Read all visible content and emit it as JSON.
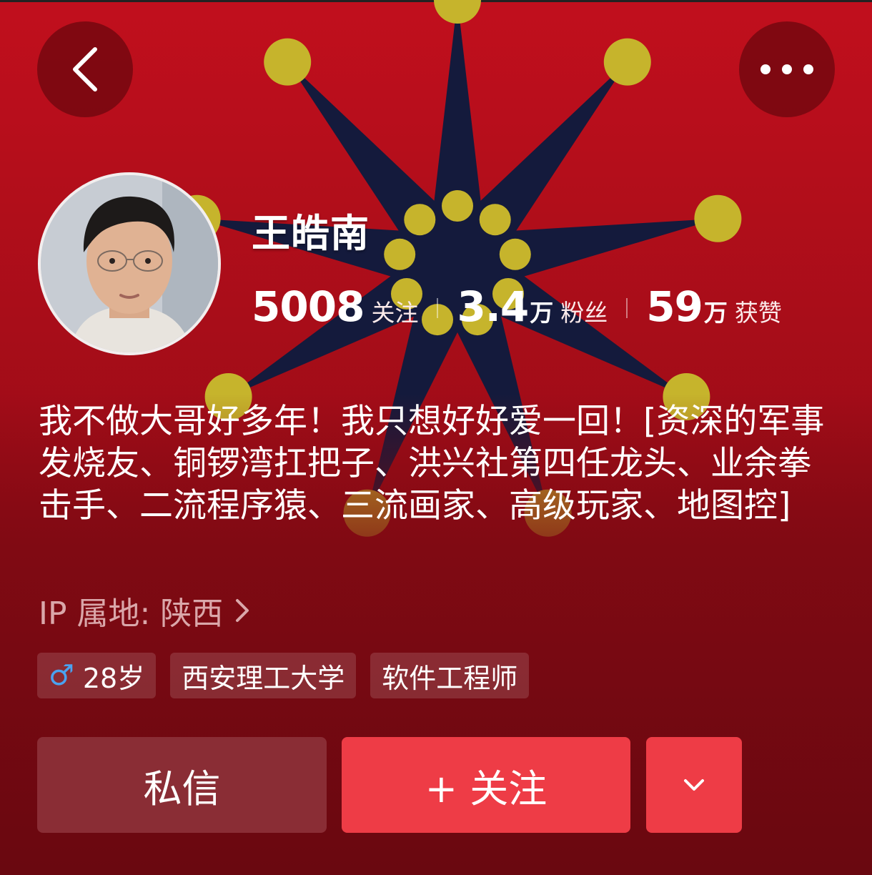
{
  "profile": {
    "name": "王皓南",
    "stats": [
      {
        "value": "5008",
        "unit": "",
        "label": "关注"
      },
      {
        "value": "3.4",
        "unit": "万",
        "label": "粉丝"
      },
      {
        "value": "59",
        "unit": "万",
        "label": "获赞"
      }
    ],
    "bio": "我不做大哥好多年！我只想好好爱一回！[资深的军事发烧友、铜锣湾扛把子、洪兴社第四任龙头、业余拳击手、二流程序猿、三流画家、高级玩家、地图控]",
    "ip_location": "IP 属地: 陕西",
    "tags": [
      {
        "icon": "male-icon",
        "label": "28岁"
      },
      {
        "label": "西安理工大学"
      },
      {
        "label": "软件工程师"
      }
    ]
  },
  "nav": {
    "back_icon": "back-arrow-icon",
    "more_icon": "more-dots-icon"
  },
  "actions": {
    "message_label": "私信",
    "follow_label": "+ 关注",
    "dropdown_icon": "chevron-down-icon"
  },
  "colors": {
    "background": "#8f0c16",
    "star": "#141a3c",
    "dot": "#c6b42c",
    "follow_button": "#ee3c46",
    "message_button": "#8a2d35",
    "male_icon": "#4aa2f0"
  }
}
